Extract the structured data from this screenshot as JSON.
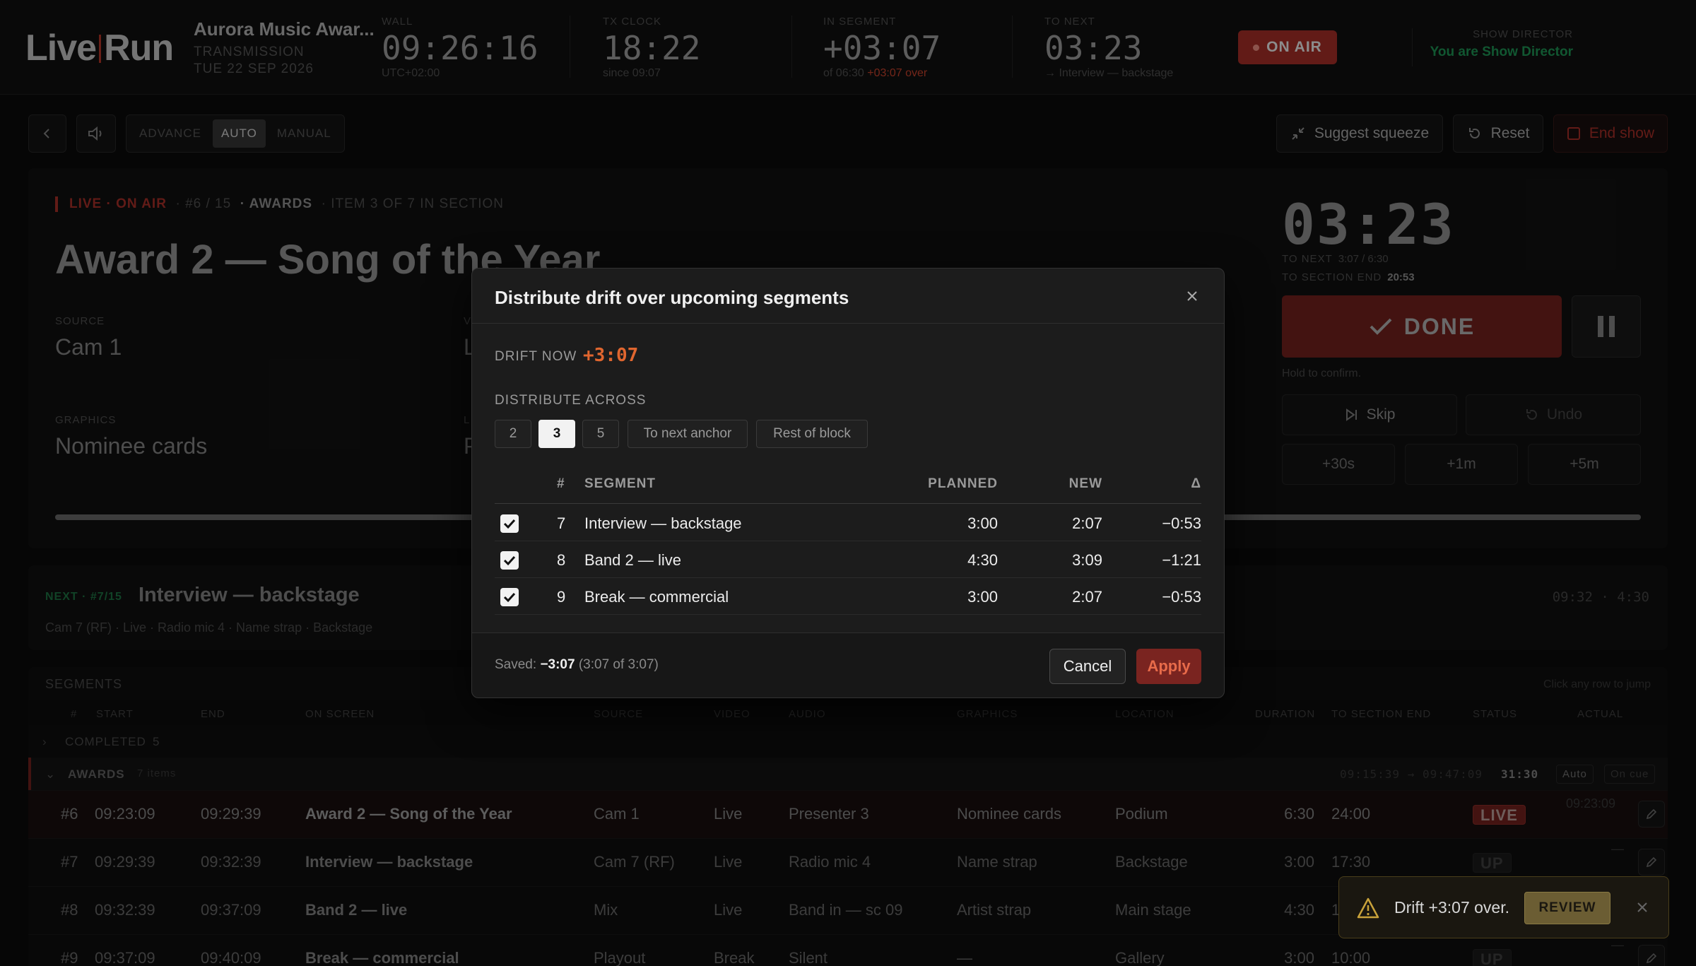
{
  "app": {
    "logo_left": "Live",
    "logo_right": "Run"
  },
  "header": {
    "show_title": "Aurora Music Awar...",
    "show_sub1": "TRANSMISSION",
    "show_sub2": "TUE 22 SEP 2026",
    "wall": {
      "label": "WALL",
      "value": "09:26:16",
      "sub": "UTC+02:00"
    },
    "tx": {
      "label": "TX CLOCK",
      "value": "18:22",
      "sub": "since 09:07"
    },
    "in_segment": {
      "label": "IN SEGMENT",
      "value": "+03:07",
      "sub": "of 06:30",
      "over": "+03:07 over"
    },
    "to_next": {
      "label": "TO NEXT",
      "value": "03:23",
      "sub": "→ Interview — backstage"
    },
    "on_air": "ON AIR",
    "director_label": "SHOW DIRECTOR",
    "director_value": "You are Show Director"
  },
  "toolbar": {
    "mode_advance": "ADVANCE",
    "mode_auto": "AUTO",
    "mode_manual": "MANUAL",
    "suggest": "Suggest squeeze",
    "reset": "Reset",
    "end_show": "End show"
  },
  "live": {
    "tag_live": "LIVE · ON AIR",
    "tag_pos": "· #6 / 15",
    "tag_section": "· AWARDS",
    "tag_item": "· ITEM 3 OF 7 IN SECTION",
    "title": "Award 2 — Song of the Year",
    "source_label": "SOURCE",
    "source_value": "Cam 1",
    "video_label": "V",
    "video_value": "L",
    "graphics_label": "GRAPHICS",
    "graphics_value": "Nominee cards",
    "location_label": "L",
    "location_value": "P",
    "progress": 1.0,
    "timer": "03:23",
    "to_next_label": "TO NEXT",
    "to_next_value": "3:07 / 6:30",
    "to_section_label": "TO SECTION END",
    "to_section_value": "20:53",
    "done": "DONE",
    "hold": "Hold to confirm.",
    "skip": "Skip",
    "undo": "Undo",
    "add30": "+30s",
    "add1": "+1m",
    "add5": "+5m"
  },
  "next": {
    "tag": "NEXT · #7/15",
    "title": "Interview — backstage",
    "meta": "Cam 7 (RF) · Live · Radio mic 4 · Name strap · Backstage",
    "time": "09:32 · 4:30"
  },
  "segments": {
    "heading": "SEGMENTS",
    "hint": "Click any row to jump",
    "columns": [
      "#",
      "START",
      "END",
      "ON SCREEN",
      "SOURCE",
      "VIDEO",
      "AUDIO",
      "GRAPHICS",
      "LOCATION",
      "DURATION",
      "TO SECTION END",
      "STATUS",
      "ACTUAL"
    ],
    "completed": {
      "label": "COMPLETED",
      "count": "5"
    },
    "awards": {
      "label": "AWARDS",
      "count": "7 items",
      "range": "09:15:39 → 09:47:09",
      "total": "31:30",
      "auto": "Auto",
      "oncue": "On cue"
    },
    "rows": [
      {
        "num": "#6",
        "start": "09:23:09",
        "end": "09:29:39",
        "screen": "Award 2 — Song of the Year",
        "source": "Cam 1",
        "video": "Live",
        "audio": "Presenter 3",
        "graphics": "Nominee cards",
        "location": "Podium",
        "duration": "6:30",
        "to_end": "24:00",
        "status": "LIVE",
        "actual": "09:23:09"
      },
      {
        "num": "#7",
        "start": "09:29:39",
        "end": "09:32:39",
        "screen": "Interview — backstage",
        "source": "Cam 7 (RF)",
        "video": "Live",
        "audio": "Radio mic 4",
        "graphics": "Name strap",
        "location": "Backstage",
        "duration": "3:00",
        "to_end": "17:30",
        "status": "UP",
        "actual": "—"
      },
      {
        "num": "#8",
        "start": "09:32:39",
        "end": "09:37:09",
        "screen": "Band 2 — live",
        "source": "Mix",
        "video": "Live",
        "audio": "Band in — sc 09",
        "graphics": "Artist strap",
        "location": "Main stage",
        "duration": "4:30",
        "to_end": "1",
        "status": "UP",
        "actual": "—"
      },
      {
        "num": "#9",
        "start": "09:37:09",
        "end": "09:40:09",
        "screen": "Break — commercial",
        "source": "Playout",
        "video": "Break",
        "audio": "Silent",
        "graphics": "—",
        "location": "Gallery",
        "duration": "3:00",
        "to_end": "10:00",
        "status": "UP",
        "actual": "—"
      }
    ]
  },
  "modal": {
    "title": "Distribute drift over upcoming segments",
    "drift_label": "DRIFT NOW",
    "drift_value": "+3:07",
    "distribute_label": "DISTRIBUTE ACROSS",
    "options": [
      "2",
      "3",
      "5",
      "To next anchor",
      "Rest of block"
    ],
    "selected_option": "3",
    "headers": {
      "num": "#",
      "segment": "SEGMENT",
      "planned": "PLANNED",
      "new": "NEW",
      "delta": "Δ"
    },
    "rows": [
      {
        "num": "7",
        "segment": "Interview — backstage",
        "planned": "3:00",
        "new": "2:07",
        "delta": "−0:53",
        "checked": true
      },
      {
        "num": "8",
        "segment": "Band 2 — live",
        "planned": "4:30",
        "new": "3:09",
        "delta": "−1:21",
        "checked": true
      },
      {
        "num": "9",
        "segment": "Break — commercial",
        "planned": "3:00",
        "new": "2:07",
        "delta": "−0:53",
        "checked": true
      }
    ],
    "saved_label": "Saved:",
    "saved_value": "−3:07",
    "saved_detail": "(3:07 of 3:07)",
    "cancel": "Cancel",
    "apply": "Apply"
  },
  "toast": {
    "message": "Drift +3:07 over.",
    "review": "REVIEW"
  }
}
